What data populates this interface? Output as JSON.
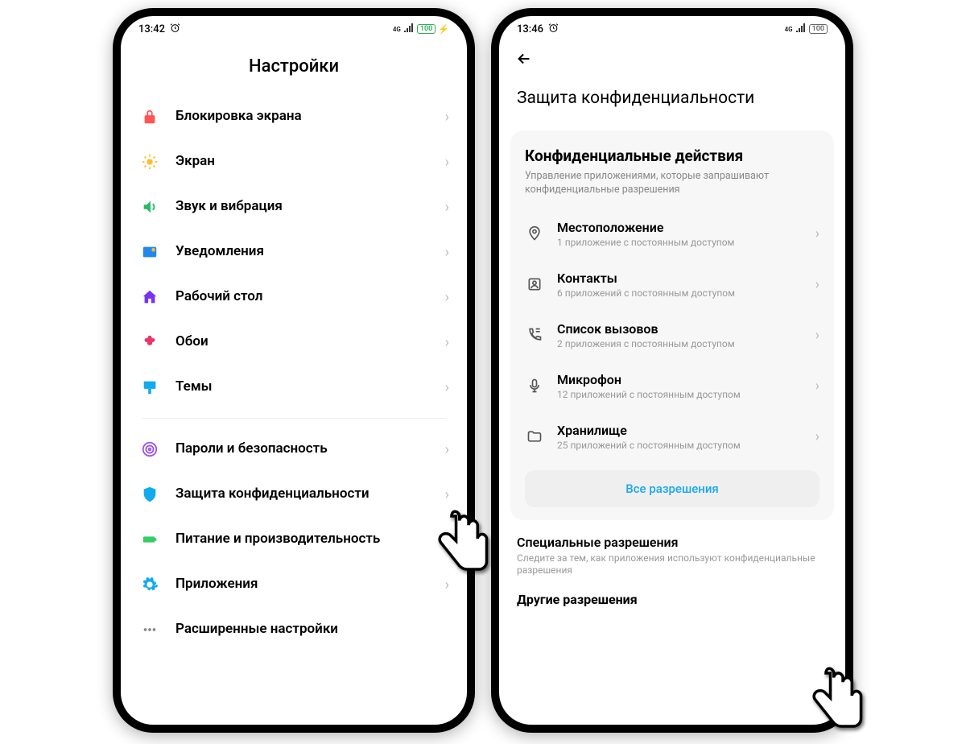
{
  "phone1": {
    "status": {
      "time": "13:42",
      "net": "4G",
      "battery": "100"
    },
    "title": "Настройки",
    "items": [
      {
        "label": "Блокировка экрана"
      },
      {
        "label": "Экран"
      },
      {
        "label": "Звук и вибрация"
      },
      {
        "label": "Уведомления"
      },
      {
        "label": "Рабочий стол"
      },
      {
        "label": "Обои"
      },
      {
        "label": "Темы"
      }
    ],
    "items2": [
      {
        "label": "Пароли и безопасность"
      },
      {
        "label": "Защита конфиденциальности"
      },
      {
        "label": "Питание и производительность"
      },
      {
        "label": "Приложения"
      },
      {
        "label": "Расширенные настройки"
      }
    ]
  },
  "phone2": {
    "status": {
      "time": "13:46",
      "net": "4G",
      "battery": "100"
    },
    "title": "Защита конфиденциальности",
    "card": {
      "title": "Конфиденциальные действия",
      "subtitle": "Управление приложениями, которые запрашивают конфиденциальные разрешения",
      "perms": [
        {
          "label": "Местоположение",
          "sub": "1 приложение с постоянным доступом"
        },
        {
          "label": "Контакты",
          "sub": "6 приложений с постоянным доступом"
        },
        {
          "label": "Список вызовов",
          "sub": "2 приложения с постоянным доступом"
        },
        {
          "label": "Микрофон",
          "sub": "12 приложений с постоянным доступом"
        },
        {
          "label": "Хранилище",
          "sub": "25 приложений с постоянным доступом"
        }
      ],
      "button": "Все разрешения"
    },
    "special": {
      "title": "Специальные разрешения",
      "sub": "Следите за тем, как приложения используют конфиденциальные разрешения"
    },
    "cutoff_title": "Другие разрешения"
  }
}
